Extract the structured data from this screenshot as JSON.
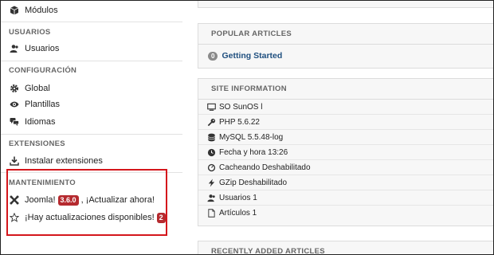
{
  "sidebar": {
    "modulos_label": "Módulos",
    "users_heading": "USUARIOS",
    "users_label": "Usuarios",
    "config_heading": "CONFIGURACIÓN",
    "global_label": "Global",
    "templates_label": "Plantillas",
    "languages_label": "Idiomas",
    "extensions_heading": "EXTENSIONES",
    "install_label": "Instalar extensiones",
    "maintenance_heading": "MANTENIMIENTO",
    "joomla_label": "Joomla!",
    "joomla_version": "3.6.0",
    "joomla_update": ", ¡Actualizar ahora!",
    "updates_label": "¡Hay actualizaciones disponibles!",
    "updates_count": "2"
  },
  "popular": {
    "heading": "POPULAR ARTICLES",
    "count": "0",
    "article": "Getting Started"
  },
  "siteinfo": {
    "heading": "SITE INFORMATION",
    "os": "SO SunOS l",
    "php": "PHP 5.6.22",
    "mysql": "MySQL 5.5.48-log",
    "time": "Fecha y hora 13:26",
    "cache": "Cacheando Deshabilitado",
    "gzip": "GZip Deshabilitado",
    "users": "Usuarios 1",
    "articles": "Artículos 1"
  },
  "recent": {
    "heading": "RECENTLY ADDED ARTICLES"
  },
  "colors": {
    "highlight_border": "#d4161c",
    "badge_red": "#b52a2f",
    "link_blue": "#1f4f7f"
  }
}
